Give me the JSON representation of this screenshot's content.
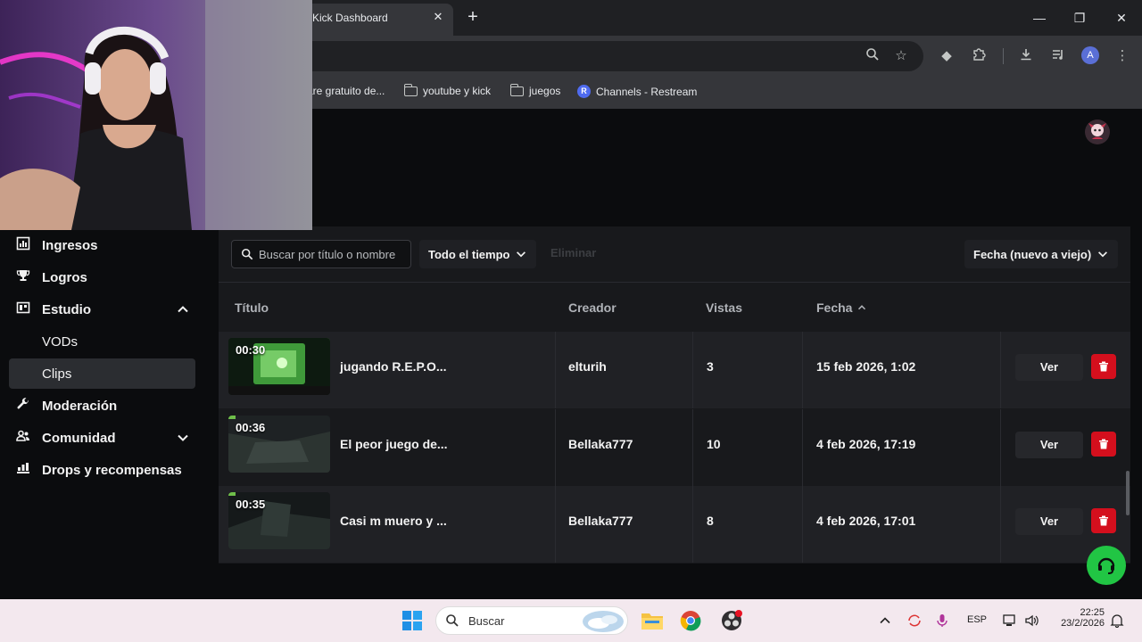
{
  "browser": {
    "tab_title": "Kick Dashboard",
    "tab_close": "✕",
    "new_tab": "+",
    "window": {
      "minimize": "—",
      "restore": "❐",
      "close": "✕"
    },
    "bookmarks": [
      {
        "label": "are gratuito de...",
        "icon": "none"
      },
      {
        "label": "youtube y kick",
        "icon": "folder-icon"
      },
      {
        "label": "juegos",
        "icon": "folder-icon"
      },
      {
        "label": "Channels - Restream",
        "icon": "restream-icon",
        "icon_letter": "R"
      }
    ],
    "avatar_letter": "A"
  },
  "sidebar": {
    "items": [
      {
        "label": "Ingresos",
        "icon": "bar-chart-icon"
      },
      {
        "label": "Logros",
        "icon": "trophy-icon"
      },
      {
        "label": "Estudio",
        "icon": "studio-icon",
        "expanded": true
      },
      {
        "label": "VODs",
        "sub": true
      },
      {
        "label": "Clips",
        "sub": true,
        "active": true
      },
      {
        "label": "Moderación",
        "icon": "wrench-icon"
      },
      {
        "label": "Comunidad",
        "icon": "people-icon",
        "expanded": false
      },
      {
        "label": "Drops y recompensas",
        "icon": "drops-icon"
      }
    ]
  },
  "filters": {
    "search_placeholder": "Buscar por título o nombre",
    "time_range": "Todo el tiempo",
    "disabled_action": "Eliminar",
    "sort": "Fecha (nuevo a viejo)"
  },
  "table": {
    "headers": {
      "title": "Título",
      "creator": "Creador",
      "views": "Vistas",
      "date": "Fecha"
    },
    "rows": [
      {
        "duration": "00:30",
        "title": "jugando R.E.P.O...",
        "creator": "elturih",
        "views": "3",
        "date": "15 feb 2026, 1:02",
        "action": "Ver"
      },
      {
        "duration": "00:36",
        "title": "El peor juego de...",
        "creator": "Bellaka777",
        "views": "10",
        "date": "4 feb 2026, 17:19",
        "action": "Ver"
      },
      {
        "duration": "00:35",
        "title": "Casi m muero y ...",
        "creator": "Bellaka777",
        "views": "8",
        "date": "4 feb 2026, 17:01",
        "action": "Ver"
      }
    ]
  },
  "taskbar": {
    "search_placeholder": "Buscar",
    "language": "ESP",
    "time": "22:25",
    "date": "23/2/2026"
  },
  "colors": {
    "accent_green": "#21c544",
    "delete_red": "#d40f1d"
  }
}
